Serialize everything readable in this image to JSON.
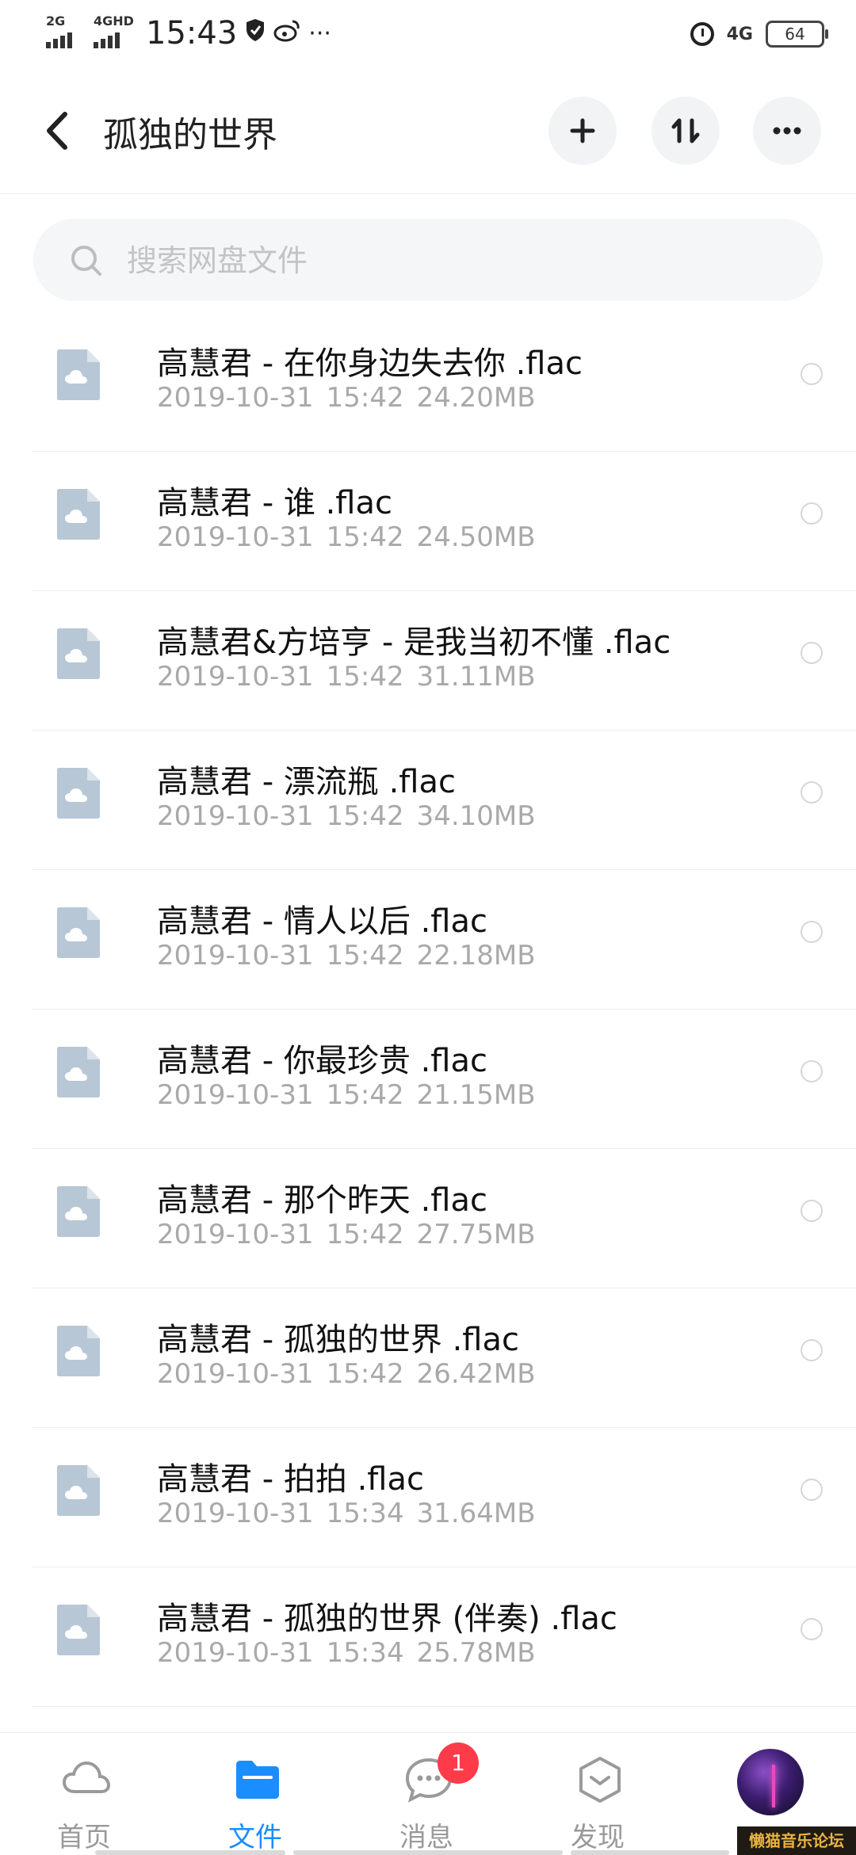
{
  "status_bar": {
    "network_1": "2G",
    "network_2": "4GHD",
    "time": "15:43",
    "network_right": "4G",
    "battery": "64",
    "overflow": "···"
  },
  "header": {
    "title": "孤独的世界",
    "add_icon": "plus-icon",
    "sort_icon": "sort-icon",
    "more_icon": "more-icon"
  },
  "search": {
    "placeholder": "搜索网盘文件"
  },
  "files": [
    {
      "name": "高慧君 - 在你身边失去你 .flac",
      "date": "2019-10-31",
      "time": "15:42",
      "size": "24.20MB"
    },
    {
      "name": "高慧君 - 谁 .flac",
      "date": "2019-10-31",
      "time": "15:42",
      "size": "24.50MB"
    },
    {
      "name": "高慧君&方培亨 - 是我当初不懂 .flac",
      "date": "2019-10-31",
      "time": "15:42",
      "size": "31.11MB"
    },
    {
      "name": "高慧君 - 漂流瓶 .flac",
      "date": "2019-10-31",
      "time": "15:42",
      "size": "34.10MB"
    },
    {
      "name": "高慧君 - 情人以后 .flac",
      "date": "2019-10-31",
      "time": "15:42",
      "size": "22.18MB"
    },
    {
      "name": "高慧君 - 你最珍贵 .flac",
      "date": "2019-10-31",
      "time": "15:42",
      "size": "21.15MB"
    },
    {
      "name": "高慧君 - 那个昨天 .flac",
      "date": "2019-10-31",
      "time": "15:42",
      "size": "27.75MB"
    },
    {
      "name": "高慧君 - 孤独的世界 .flac",
      "date": "2019-10-31",
      "time": "15:42",
      "size": "26.42MB"
    },
    {
      "name": "高慧君 - 拍拍 .flac",
      "date": "2019-10-31",
      "time": "15:34",
      "size": "31.64MB"
    },
    {
      "name": "高慧君 - 孤独的世界 (伴奏) .flac",
      "date": "2019-10-31",
      "time": "15:34",
      "size": "25.78MB"
    }
  ],
  "bottom_nav": {
    "items": [
      {
        "label": "首页",
        "icon": "cloud-home-icon",
        "active": false
      },
      {
        "label": "文件",
        "icon": "folder-icon",
        "active": true
      },
      {
        "label": "消息",
        "icon": "chat-icon",
        "active": false,
        "badge": "1"
      },
      {
        "label": "发现",
        "icon": "discover-icon",
        "active": false
      }
    ]
  },
  "watermark": "懒猫音乐论坛",
  "colors": {
    "accent": "#1a8dff",
    "badge": "#ff3b4a",
    "file_icon": "#b7c7d6"
  }
}
